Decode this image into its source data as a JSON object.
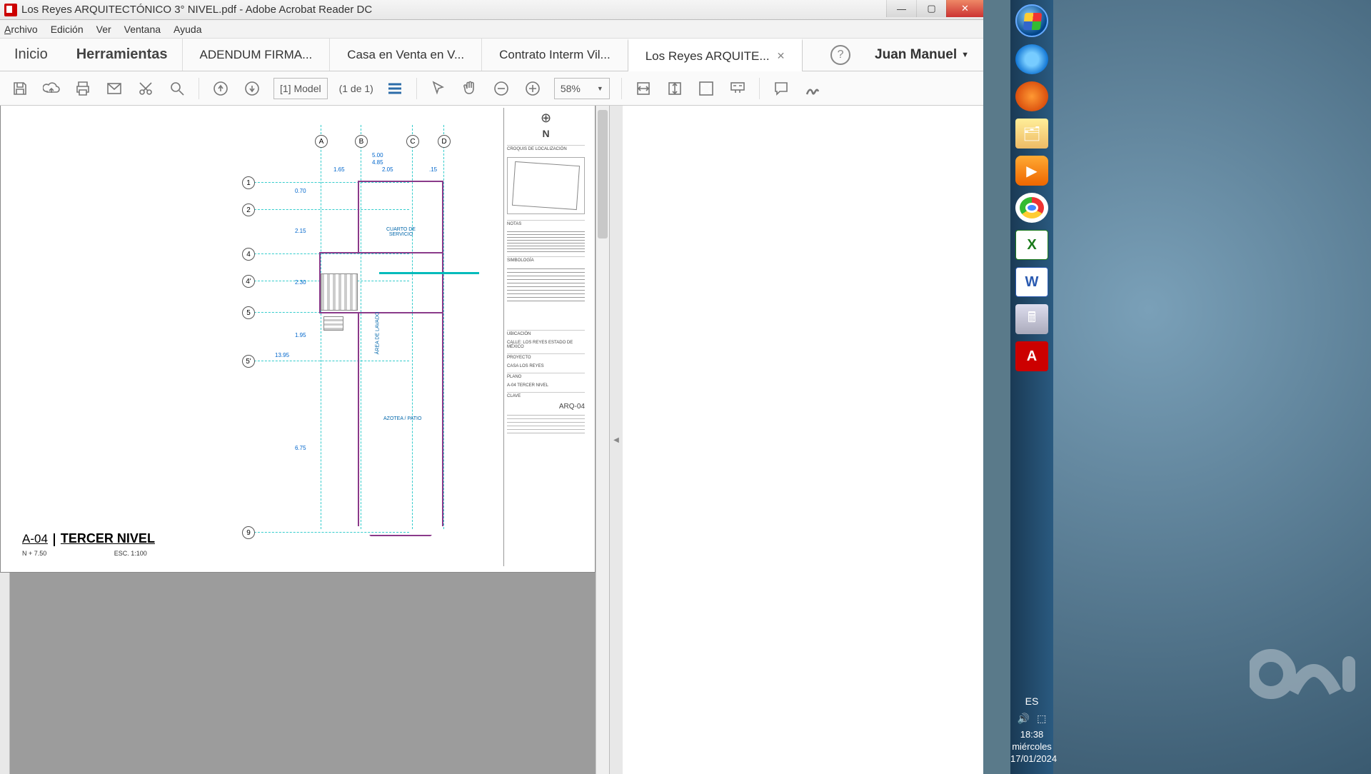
{
  "titlebar": {
    "filename": "Los Reyes ARQUITECTÓNICO 3° NIVEL.pdf",
    "app": "Adobe Acrobat Reader DC"
  },
  "menu": {
    "file": "Archivo",
    "edit": "Edición",
    "view": "Ver",
    "window": "Ventana",
    "help": "Ayuda"
  },
  "maintabs": {
    "home": "Inicio",
    "tools": "Herramientas"
  },
  "doctabs": [
    {
      "label": "ADENDUM FIRMA...",
      "active": false
    },
    {
      "label": "Casa en Venta en V...",
      "active": false
    },
    {
      "label": "Contrato Interm Vil...",
      "active": false
    },
    {
      "label": "Los Reyes ARQUITE...",
      "active": true
    }
  ],
  "user": "Juan Manuel",
  "toolbar": {
    "page_label": "[1] Model",
    "page_count": "(1 de 1)",
    "zoom": "58%"
  },
  "drawing": {
    "sheet_code": "A-04",
    "sheet_name": "TERCER NIVEL",
    "level": "N + 7.50",
    "scale": "ESC. 1:100",
    "north": "N",
    "axis_v": [
      "A",
      "B",
      "C",
      "D"
    ],
    "axis_h": [
      "1",
      "2",
      "4",
      "4'",
      "5",
      "5'",
      "9"
    ],
    "dims_top": [
      "5.00",
      "4.85",
      "1.65",
      "2.05",
      ".15"
    ],
    "dims_left": [
      "0.70",
      "2.15",
      "2.30",
      "1.95",
      "13.95",
      "6.75"
    ],
    "rooms": {
      "servicio": "CUARTO DE\nSERVICIO",
      "lavado": "ÁREA DE LAVADO",
      "azotea": "AZOTEA / PATIO"
    },
    "titleblock": {
      "croquis": "CROQUIS DE LOCALIZACIÓN",
      "notas": "NOTAS",
      "simbologia": "SIMBOLOGÍA",
      "ubicacion_h": "UBICACIÓN",
      "ubicacion": "CALLE:   LOS REYES ESTADO DE MÉXICO",
      "proyecto_h": "PROYECTO",
      "proyecto": "CASA LOS REYES",
      "plano_h": "PLANO",
      "plano": "A-04 TERCER NIVEL",
      "clave_h": "CLAVE",
      "clave": "ARQ-04"
    }
  },
  "tray": {
    "lang": "ES",
    "time": "18:38",
    "day": "miércoles",
    "date": "17/01/2024"
  }
}
